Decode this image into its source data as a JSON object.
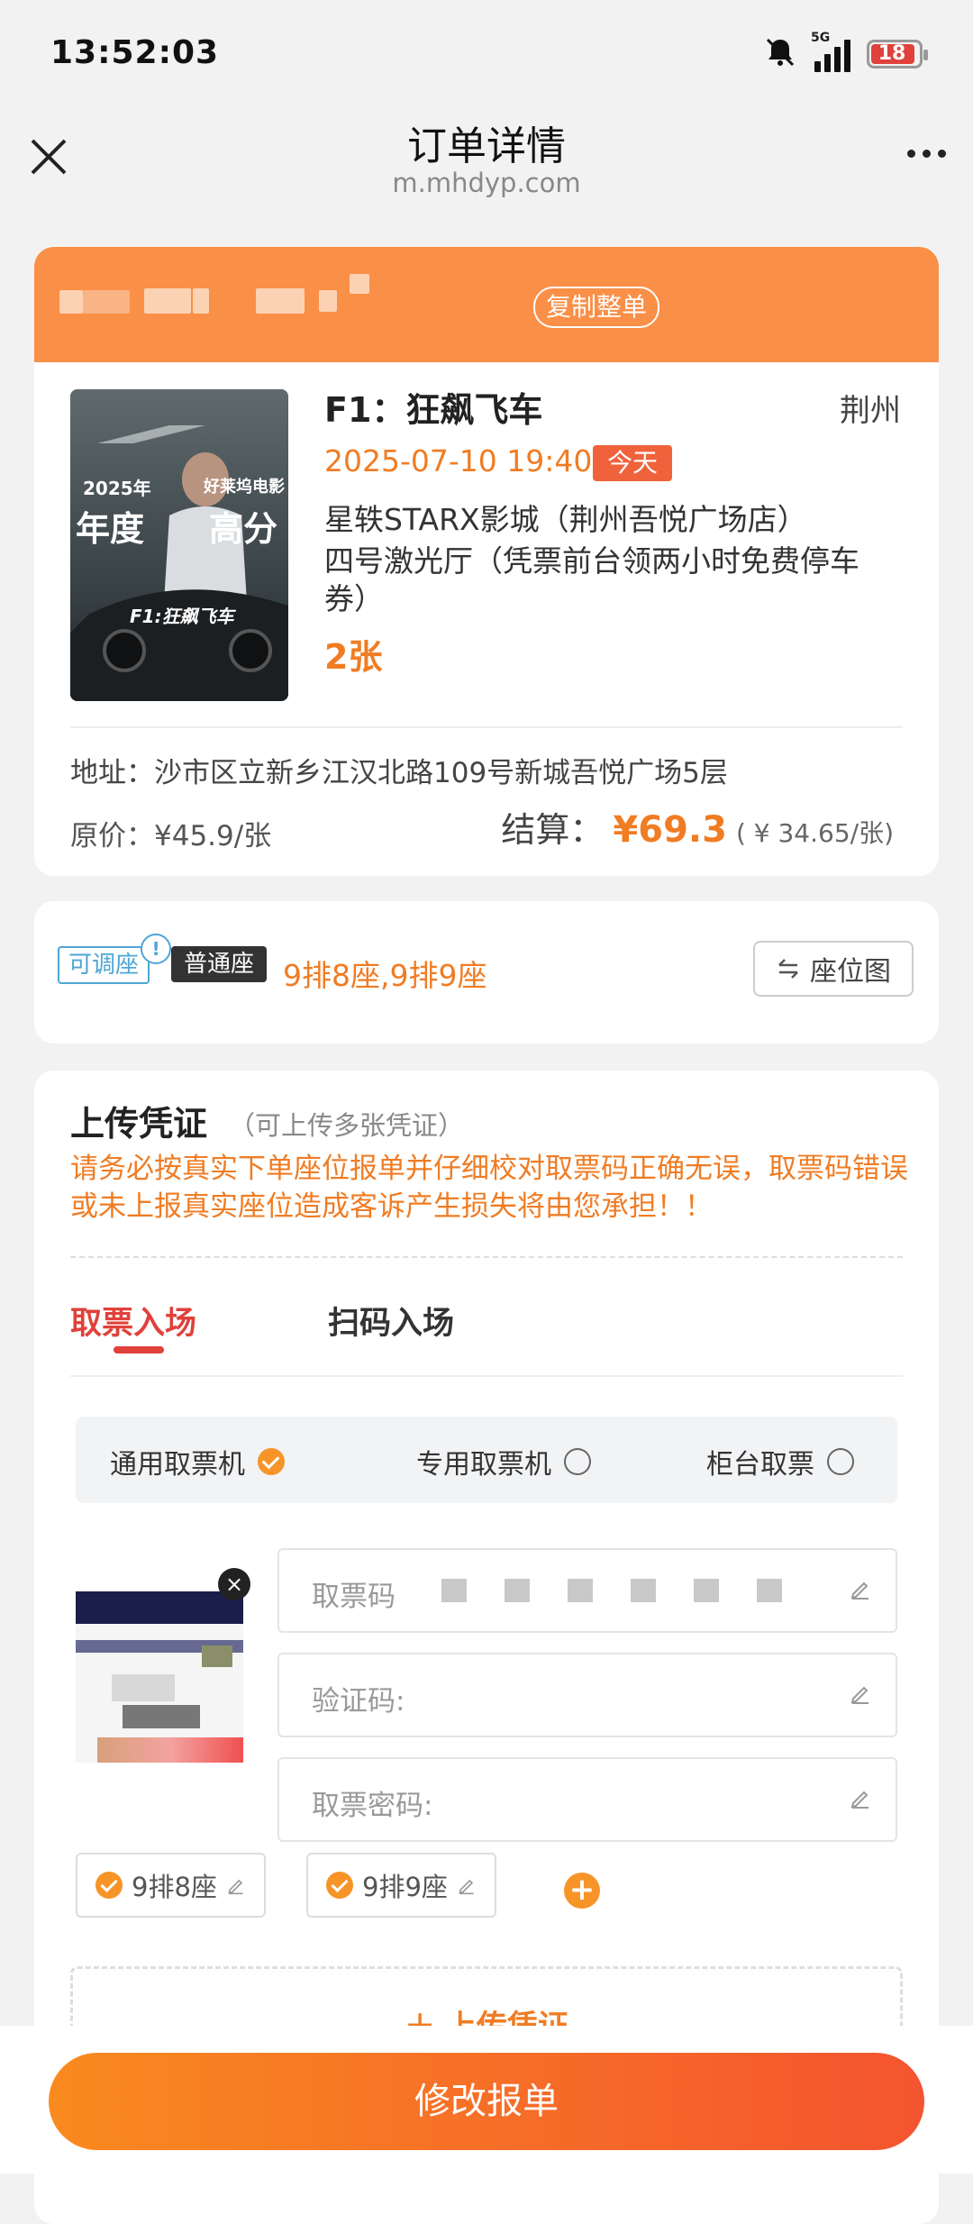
{
  "status_bar": {
    "time": "13:52:03",
    "network": "5G",
    "battery": "18"
  },
  "nav": {
    "title": "订单详情",
    "subtitle": "m.mhdyp.com"
  },
  "order": {
    "copy_label": "复制整单",
    "movie_title": "F1：狂飙飞车",
    "city": "荆州",
    "showtime": "2025-07-10 19:40",
    "today_badge": "今天",
    "cinema": "星轶STARX影城（荆州吾悦广场店）",
    "hall": "四号激光厅（凭票前台领两小时免费停车券）",
    "ticket_count": "2张",
    "address": "地址：沙市区立新乡江汉北路109号新城吾悦广场5层",
    "original_price": "原价：¥45.9/张",
    "settle_label": "结算：",
    "settle_price": "¥69.3",
    "settle_unit": "( ¥ 34.65/张)",
    "poster": {
      "top_left": "2025年",
      "top_right": "好莱坞电影",
      "big_left": "年度",
      "big_right": "高分",
      "film": "F1:狂飙飞车"
    }
  },
  "seats": {
    "adjustable_tag": "可调座",
    "info_icon": "!",
    "seat_type": "普通座",
    "seat_list": "9排8座,9排9座",
    "seatmap_label": "座位图"
  },
  "upload": {
    "title": "上传凭证",
    "hint": "（可上传多张凭证）",
    "warning": "请务必按真实下单座位报单并仔细校对取票码正确无误，取票码错误或未上报真实座位造成客诉产生损失将由您承担！！",
    "tabs": [
      "取票入场",
      "扫码入场"
    ],
    "methods": [
      "通用取票机",
      "专用取票机",
      "柜台取票"
    ],
    "fields": [
      "取票码",
      "验证码:",
      "取票密码:"
    ],
    "seat_chips": [
      "9排8座",
      "9排9座"
    ],
    "upload_label": "上传凭证"
  },
  "submit_label": "修改报单",
  "colors": {
    "accent": "#f07c23",
    "header": "#fa8f47",
    "danger": "#e0413b"
  }
}
